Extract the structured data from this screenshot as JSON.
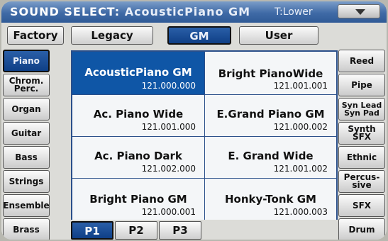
{
  "header": {
    "title_prefix": "SOUND SELECT: ",
    "title_sound": "AcousticPiano GM",
    "part": "T:Lower"
  },
  "tabs": [
    "Factory",
    "Legacy",
    "GM",
    "User"
  ],
  "selected_tab": "GM",
  "left_categories": [
    "Piano",
    "Chrom.\nPerc.",
    "Organ",
    "Guitar",
    "Bass",
    "Strings",
    "Ensemble",
    "Brass"
  ],
  "right_categories": [
    "Reed",
    "Pipe",
    "Syn Lead\nSyn Pad",
    "Synth\nSFX",
    "Ethnic",
    "Percus-\nsive",
    "SFX",
    "Drum"
  ],
  "selected_category": "Piano",
  "sounds": [
    {
      "name": "AcousticPiano GM",
      "code": "121.000.000",
      "selected": true
    },
    {
      "name": "Bright PianoWide",
      "code": "121.001.001",
      "selected": false
    },
    {
      "name": "Ac. Piano Wide",
      "code": "121.001.000",
      "selected": false
    },
    {
      "name": "E.Grand Piano GM",
      "code": "121.000.002",
      "selected": false
    },
    {
      "name": "Ac. Piano Dark",
      "code": "121.002.000",
      "selected": false
    },
    {
      "name": "E. Grand Wide",
      "code": "121.001.002",
      "selected": false
    },
    {
      "name": "Bright Piano GM",
      "code": "121.000.001",
      "selected": false
    },
    {
      "name": "Honky-Tonk GM",
      "code": "121.000.003",
      "selected": false
    }
  ],
  "pages": [
    "P1",
    "P2",
    "P3"
  ],
  "selected_page": "P1",
  "colors": {
    "accent": "#0f56a6",
    "titlebar": "#3f6aa6"
  }
}
